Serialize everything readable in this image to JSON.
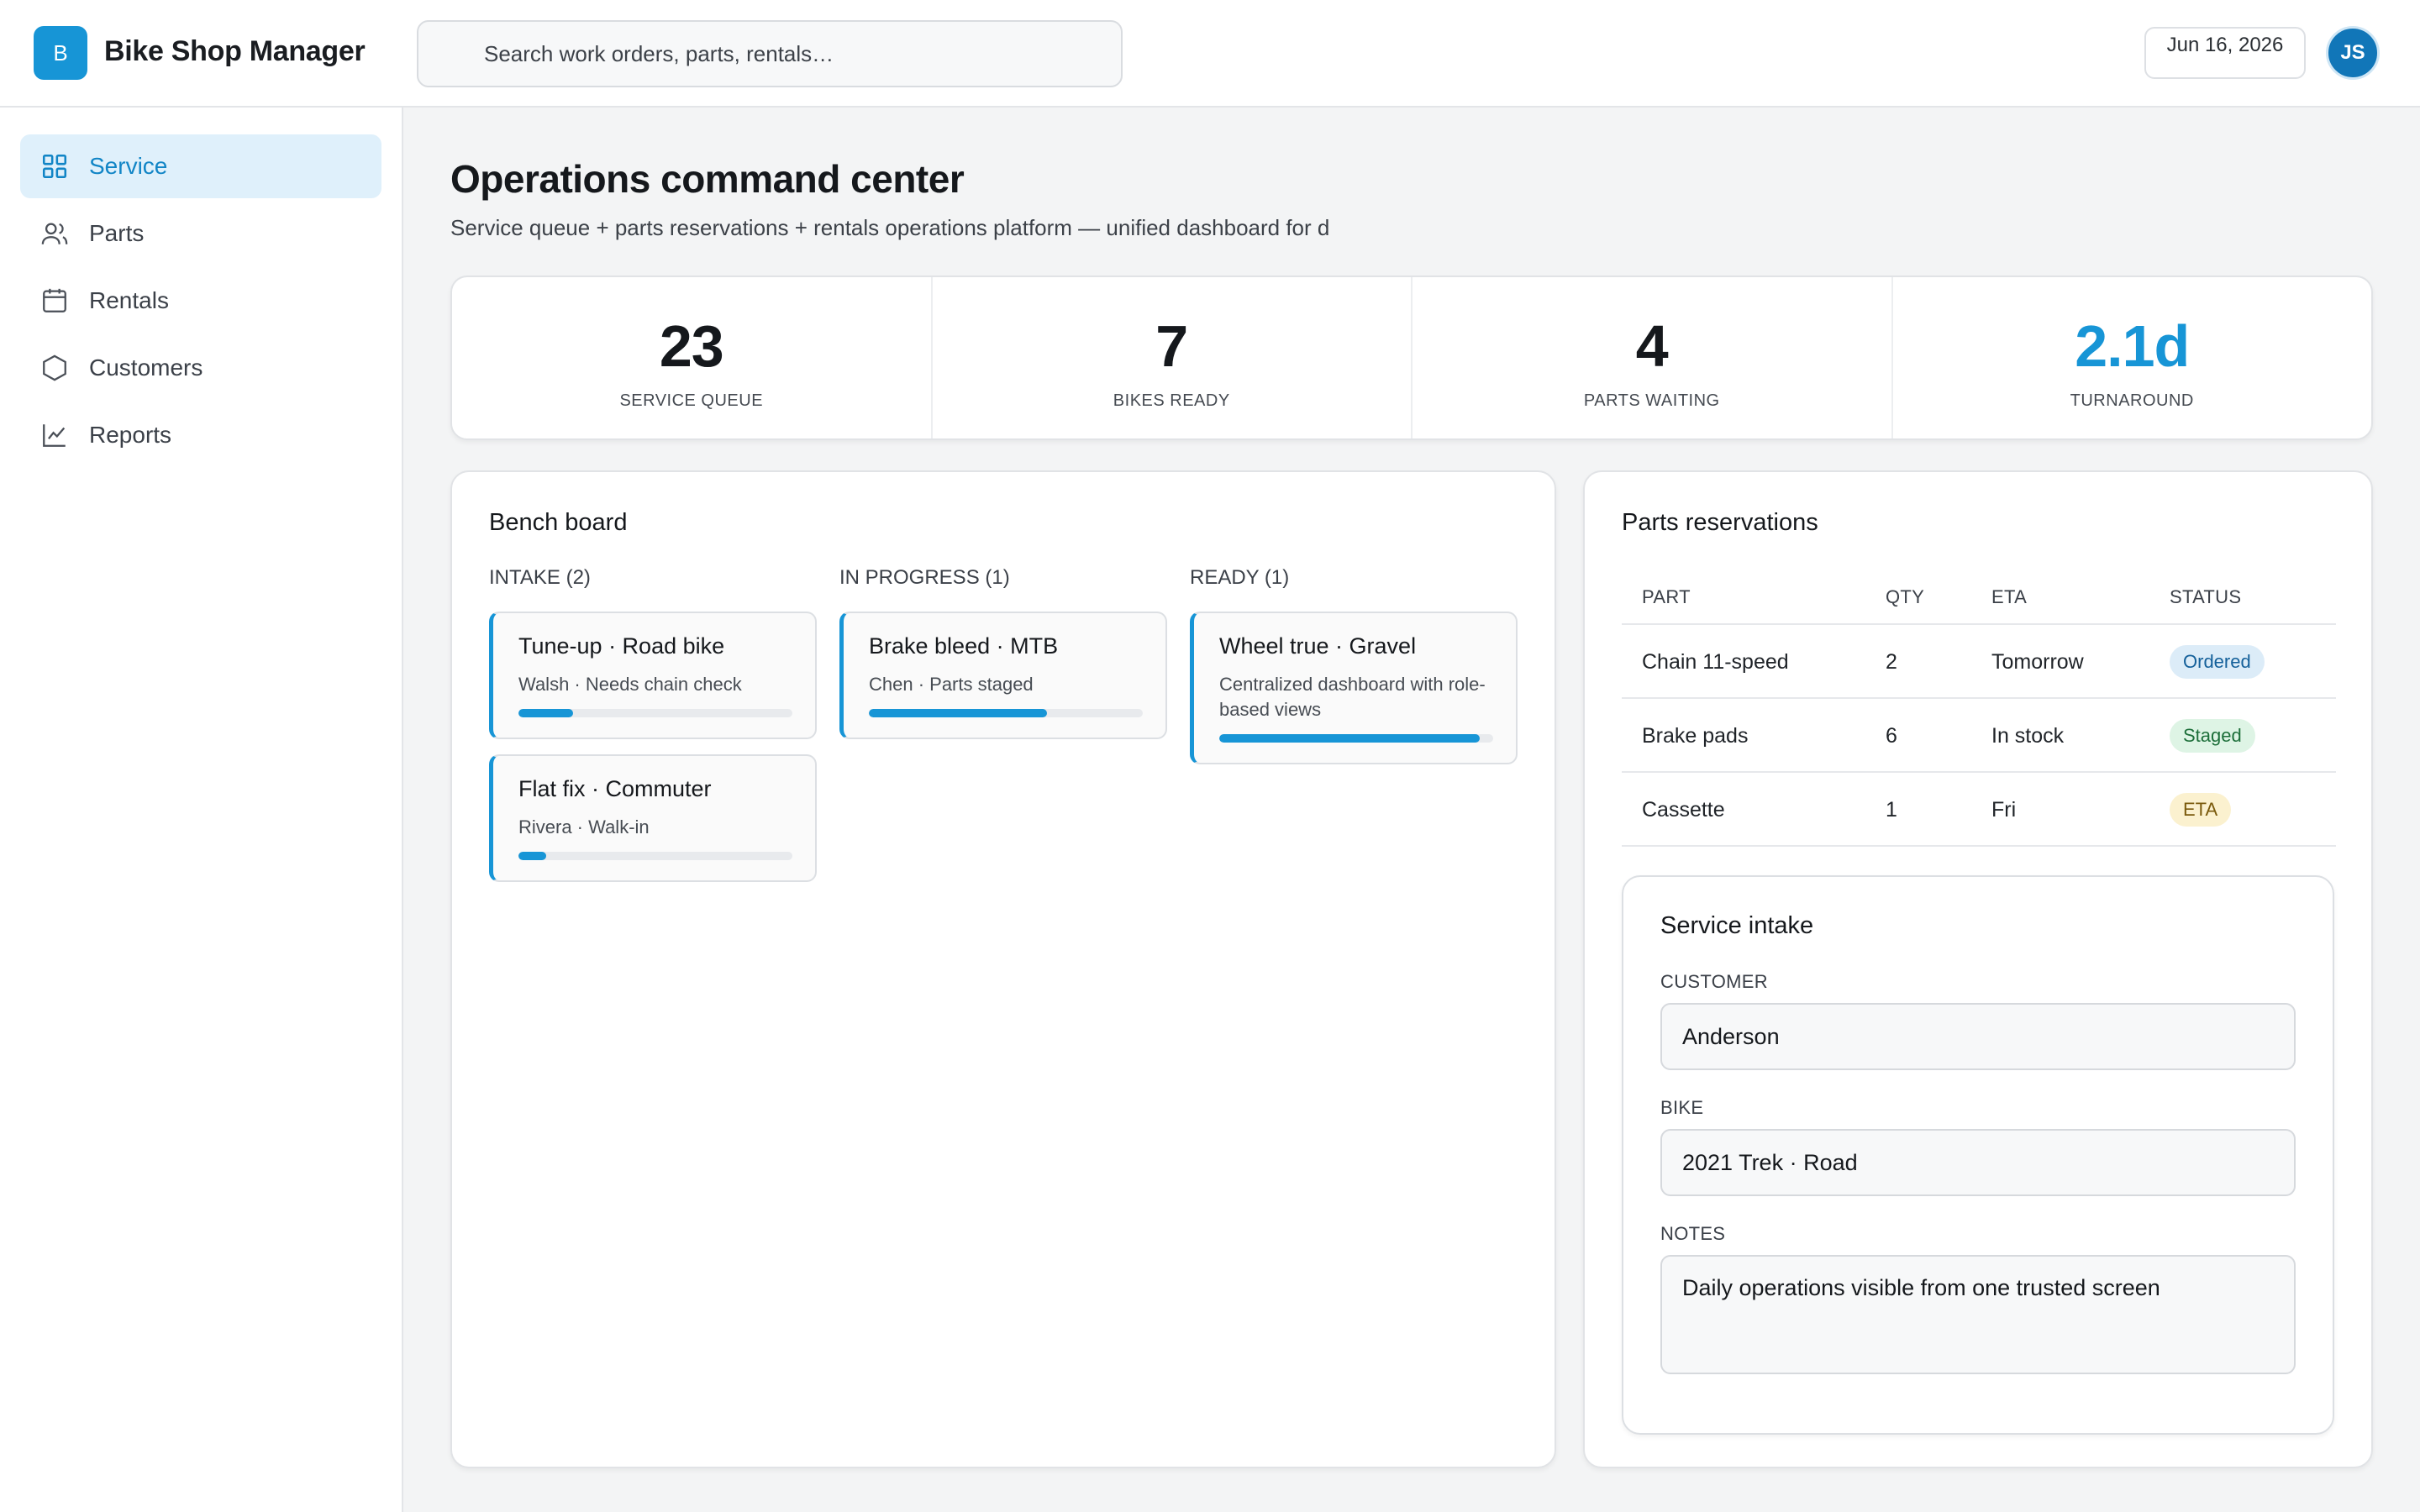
{
  "header": {
    "logo_letter": "B",
    "app_title": "Bike Shop Manager",
    "search_placeholder": "Search work orders, parts, rentals…",
    "date": "Jun 16, 2026",
    "user_initials": "JS"
  },
  "sidebar": {
    "items": [
      {
        "label": "Service",
        "icon": "grid-icon",
        "active": true
      },
      {
        "label": "Parts",
        "icon": "users-icon",
        "active": false
      },
      {
        "label": "Rentals",
        "icon": "calendar-icon",
        "active": false
      },
      {
        "label": "Customers",
        "icon": "hexagon-icon",
        "active": false
      },
      {
        "label": "Reports",
        "icon": "line-chart-icon",
        "active": false
      }
    ]
  },
  "main": {
    "title": "Operations command center",
    "subtitle": "Service queue + parts reservations + rentals operations platform — unified dashboard for d"
  },
  "kpis": [
    {
      "value": "23",
      "label": "SERVICE QUEUE"
    },
    {
      "value": "7",
      "label": "BIKES READY"
    },
    {
      "value": "4",
      "label": "PARTS WAITING"
    },
    {
      "value": "2.1d",
      "label": "TURNAROUND"
    }
  ],
  "bench": {
    "title": "Bench board",
    "columns": [
      {
        "heading": "INTAKE (2)",
        "jobs": [
          {
            "title": "Tune-up · Road bike",
            "sub": "Walsh · Needs chain check",
            "progress": 0.2
          },
          {
            "title": "Flat fix · Commuter",
            "sub": "Rivera · Walk-in",
            "progress": 0.1
          }
        ]
      },
      {
        "heading": "IN PROGRESS (1)",
        "jobs": [
          {
            "title": "Brake bleed · MTB",
            "sub": "Chen · Parts staged",
            "progress": 0.65
          }
        ]
      },
      {
        "heading": "READY (1)",
        "jobs": [
          {
            "title": "Wheel true · Gravel",
            "sub": "Centralized dashboard with role-based views",
            "progress": 0.95
          }
        ]
      }
    ]
  },
  "parts": {
    "title": "Parts reservations",
    "headers": [
      "PART",
      "QTY",
      "ETA",
      "STATUS"
    ],
    "rows": [
      {
        "part": "Chain 11-speed",
        "qty": "2",
        "eta": "Tomorrow",
        "status": "Ordered"
      },
      {
        "part": "Brake pads",
        "qty": "6",
        "eta": "In stock",
        "status": "Staged"
      },
      {
        "part": "Cassette",
        "qty": "1",
        "eta": "Fri",
        "status": "ETA"
      }
    ]
  },
  "intake": {
    "title": "Service intake",
    "customer_label": "CUSTOMER",
    "customer_value": "Anderson",
    "bike_label": "BIKE",
    "bike_value": "2021 Trek · Road",
    "notes_label": "NOTES",
    "notes_value": "Daily operations visible from one trusted screen"
  },
  "colors": {
    "accent": "#1795d6",
    "ordered_bg": "#dcecf8",
    "staged_bg": "#def4e5",
    "eta_bg": "#fbf1cf"
  }
}
